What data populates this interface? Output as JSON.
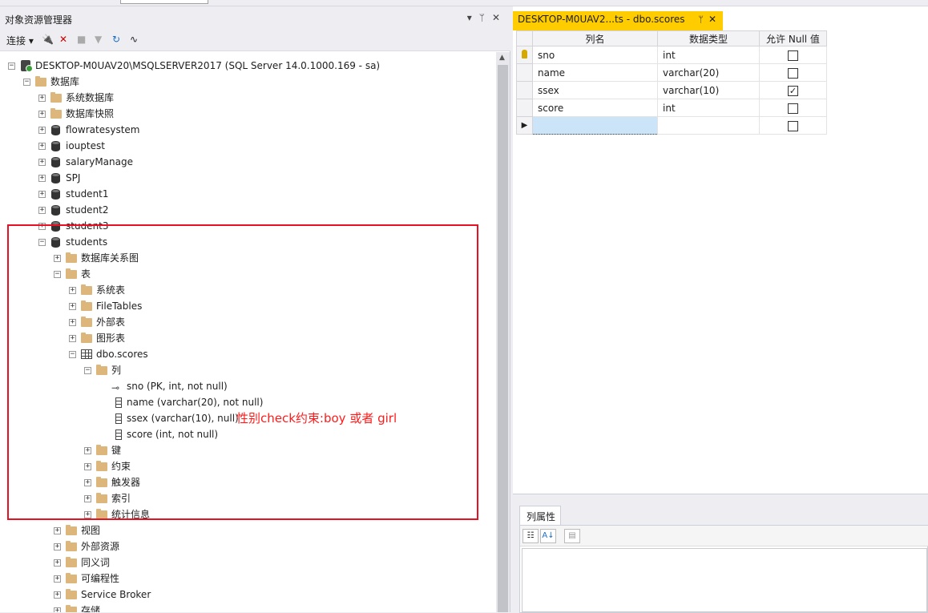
{
  "object_explorer": {
    "title": "对象资源管理器",
    "title_controls": [
      "▾",
      "ᛘ",
      "✕"
    ],
    "toolbar": {
      "connect_label": "连接"
    },
    "tree": [
      {
        "depth": 0,
        "exp": "−",
        "icon": "server",
        "label": "DESKTOP-M0UAV20\\MSQLSERVER2017 (SQL Server 14.0.1000.169 - sa)"
      },
      {
        "depth": 1,
        "exp": "−",
        "icon": "folder",
        "label": "数据库"
      },
      {
        "depth": 2,
        "exp": "+",
        "icon": "folder",
        "label": "系统数据库"
      },
      {
        "depth": 2,
        "exp": "+",
        "icon": "folder",
        "label": "数据库快照"
      },
      {
        "depth": 2,
        "exp": "+",
        "icon": "db",
        "label": "flowratesystem"
      },
      {
        "depth": 2,
        "exp": "+",
        "icon": "db",
        "label": "iouptest"
      },
      {
        "depth": 2,
        "exp": "+",
        "icon": "db",
        "label": "salaryManage"
      },
      {
        "depth": 2,
        "exp": "+",
        "icon": "db",
        "label": "SPJ"
      },
      {
        "depth": 2,
        "exp": "+",
        "icon": "db",
        "label": "student1"
      },
      {
        "depth": 2,
        "exp": "+",
        "icon": "db",
        "label": "student2"
      },
      {
        "depth": 2,
        "exp": "+",
        "icon": "db",
        "label": "student3"
      },
      {
        "depth": 2,
        "exp": "−",
        "icon": "db",
        "label": "students"
      },
      {
        "depth": 3,
        "exp": "+",
        "icon": "folder",
        "label": "数据库关系图"
      },
      {
        "depth": 3,
        "exp": "−",
        "icon": "folder",
        "label": "表"
      },
      {
        "depth": 4,
        "exp": "+",
        "icon": "folder",
        "label": "系统表"
      },
      {
        "depth": 4,
        "exp": "+",
        "icon": "folder",
        "label": "FileTables"
      },
      {
        "depth": 4,
        "exp": "+",
        "icon": "folder",
        "label": "外部表"
      },
      {
        "depth": 4,
        "exp": "+",
        "icon": "folder",
        "label": "图形表"
      },
      {
        "depth": 4,
        "exp": "−",
        "icon": "table",
        "label": "dbo.scores"
      },
      {
        "depth": 5,
        "exp": "−",
        "icon": "folder",
        "label": "列"
      },
      {
        "depth": 6,
        "exp": "",
        "icon": "key",
        "label": "sno (PK, int, not null)"
      },
      {
        "depth": 6,
        "exp": "",
        "icon": "column",
        "label": "name (varchar(20), not null)"
      },
      {
        "depth": 6,
        "exp": "",
        "icon": "column",
        "label": "ssex (varchar(10), null)",
        "annotation": "性别check约束:boy 或者 girl"
      },
      {
        "depth": 6,
        "exp": "",
        "icon": "column",
        "label": "score (int, not null)"
      },
      {
        "depth": 5,
        "exp": "+",
        "icon": "folder",
        "label": "键"
      },
      {
        "depth": 5,
        "exp": "+",
        "icon": "folder",
        "label": "约束"
      },
      {
        "depth": 5,
        "exp": "+",
        "icon": "folder",
        "label": "触发器"
      },
      {
        "depth": 5,
        "exp": "+",
        "icon": "folder",
        "label": "索引"
      },
      {
        "depth": 5,
        "exp": "+",
        "icon": "folder",
        "label": "统计信息"
      },
      {
        "depth": 3,
        "exp": "+",
        "icon": "folder",
        "label": "视图"
      },
      {
        "depth": 3,
        "exp": "+",
        "icon": "folder",
        "label": "外部资源"
      },
      {
        "depth": 3,
        "exp": "+",
        "icon": "folder",
        "label": "同义词"
      },
      {
        "depth": 3,
        "exp": "+",
        "icon": "folder",
        "label": "可编程性"
      },
      {
        "depth": 3,
        "exp": "+",
        "icon": "folder",
        "label": "Service Broker"
      },
      {
        "depth": 3,
        "exp": "+",
        "icon": "folder",
        "label": "存储"
      }
    ]
  },
  "document": {
    "tab_label": "DESKTOP-M0UAV2...ts - dbo.scores",
    "tab_pin": "ᛘ",
    "tab_close": "✕",
    "table_designer": {
      "headers": [
        "列名",
        "数据类型",
        "允许 Null 值"
      ],
      "rows": [
        {
          "name": "sno",
          "type": "int",
          "allow_null": false,
          "pk": true
        },
        {
          "name": "name",
          "type": "varchar(20)",
          "allow_null": false,
          "pk": false
        },
        {
          "name": "ssex",
          "type": "varchar(10)",
          "allow_null": true,
          "pk": false
        },
        {
          "name": "score",
          "type": "int",
          "allow_null": false,
          "pk": false
        },
        {
          "name": "",
          "type": "",
          "allow_null": false,
          "pk": false,
          "new_row": true
        }
      ]
    },
    "properties_tab": "列属性"
  },
  "colors": {
    "highlight_box": "#e81123",
    "annotation_text": "#ff1a1a",
    "active_tab": "#ffcc00"
  }
}
